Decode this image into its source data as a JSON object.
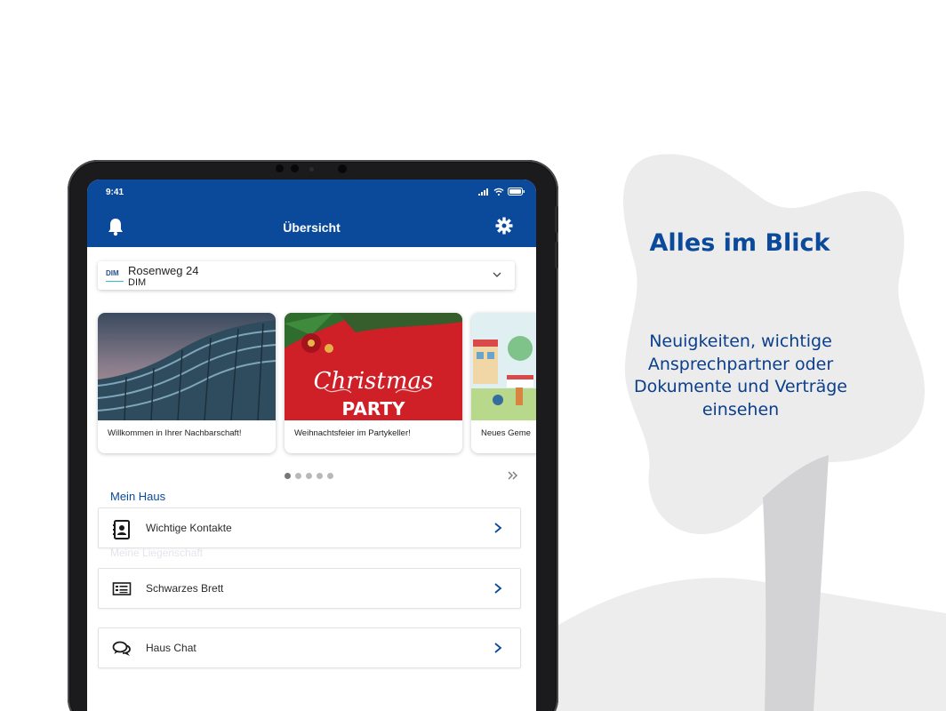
{
  "promo": {
    "title": "Alles im Blick",
    "text": "Neuigkeiten, wichtige Ansprechpartner oder Dokumente und Verträge einsehen"
  },
  "status_bar": {
    "time": "9:41"
  },
  "header": {
    "title": "Übersicht",
    "left_icon": "bell-icon",
    "right_icon": "gear-icon"
  },
  "property": {
    "logo_text": "DIM",
    "name": "Rosenweg 24",
    "subtitle": "DIM"
  },
  "carousel": {
    "cards": [
      {
        "caption": "Willkommen in Ihrer Nachbarschaft!",
        "image": "building-photo"
      },
      {
        "caption": "Weihnachtsfeier im Partykeller!",
        "image": "christmas-party-banner",
        "banner_script": "Christmas",
        "banner_word": "PARTY"
      },
      {
        "caption": "Neues Geme",
        "image": "neighborhood-illustration"
      }
    ],
    "page_count": 5,
    "active_page": 1,
    "more_icon": "double-chevron-right-icon"
  },
  "section": {
    "title": "Mein Haus",
    "ghost_title": "Meine Liegenschaft"
  },
  "menu": [
    {
      "label": "Wichtige Kontakte",
      "icon": "contact-book-icon"
    },
    {
      "label": "Schwarzes Brett",
      "icon": "notice-board-icon"
    },
    {
      "label": "Haus Chat",
      "icon": "chat-bubbles-icon"
    }
  ],
  "colors": {
    "brand_blue": "#0b4a9a",
    "background_blob": "#ececed"
  }
}
